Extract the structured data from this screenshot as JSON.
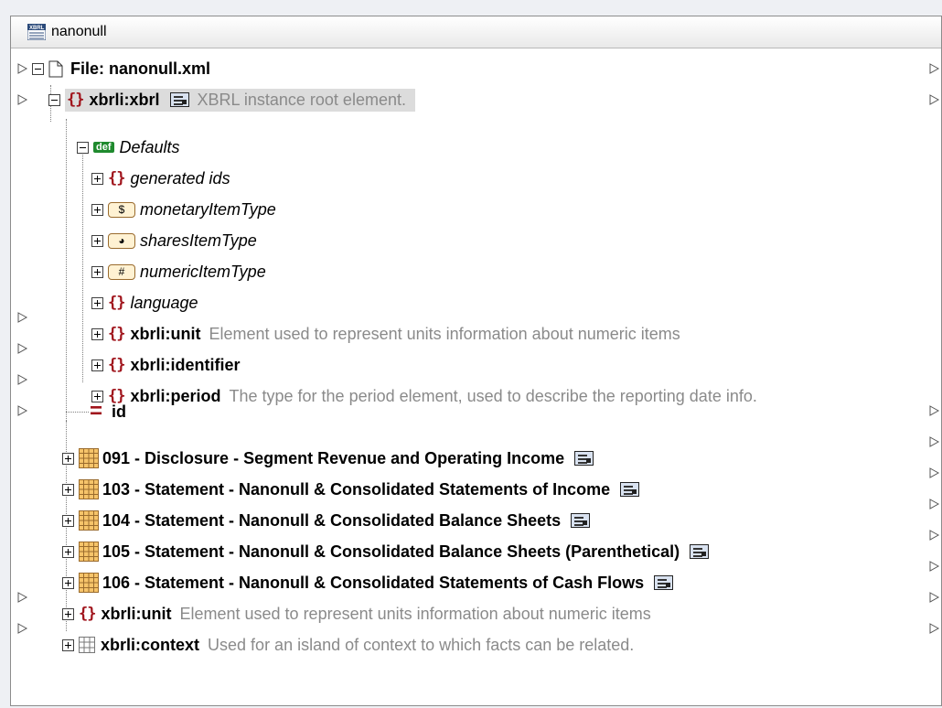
{
  "window": {
    "title": "nanonull",
    "title_icon": "xbrl-component-icon"
  },
  "tree": [
    {
      "label": "File: nanonull.xml",
      "icon": "file-icon",
      "toggle": "minus"
    },
    {
      "label": "xbrli:xbrl",
      "desc": "XBRL instance root element.",
      "icon": "element-icon",
      "toggle": "minus",
      "annotation": true
    },
    {
      "label": "Defaults",
      "icon": "def-icon",
      "icon_text": "def",
      "toggle": "minus"
    },
    {
      "label": "generated ids",
      "icon": "element-icon",
      "toggle": "plus"
    },
    {
      "label": "monetaryItemType",
      "icon": "monetary-type-icon",
      "icon_text": "$",
      "toggle": "plus"
    },
    {
      "label": "sharesItemType",
      "icon": "shares-type-icon",
      "icon_text": "◕",
      "toggle": "plus"
    },
    {
      "label": "numericItemType",
      "icon": "numeric-type-icon",
      "icon_text": "#",
      "toggle": "plus"
    },
    {
      "label": "language",
      "icon": "element-icon",
      "toggle": "plus"
    },
    {
      "label": "xbrli:unit",
      "desc": "Element used to represent units information about numeric items",
      "icon": "element-icon",
      "toggle": "plus"
    },
    {
      "label": "xbrli:identifier",
      "icon": "element-icon",
      "toggle": "plus"
    },
    {
      "label": "xbrli:period",
      "desc": "The type for the period element, used to describe the reporting date info.",
      "icon": "element-icon",
      "toggle": "plus"
    },
    {
      "label": "id",
      "icon": "attribute-icon"
    },
    {
      "label": "091 - Disclosure - Segment Revenue and Operating Income",
      "icon": "table-icon",
      "toggle": "plus",
      "annotation": true
    },
    {
      "label": "103 - Statement - Nanonull & Consolidated Statements of Income",
      "icon": "table-icon",
      "toggle": "plus",
      "annotation": true
    },
    {
      "label": "104 - Statement - Nanonull & Consolidated Balance Sheets",
      "icon": "table-icon",
      "toggle": "plus",
      "annotation": true
    },
    {
      "label": "105 - Statement - Nanonull & Consolidated Balance Sheets (Parenthetical)",
      "icon": "table-icon",
      "toggle": "plus",
      "annotation": true
    },
    {
      "label": "106 - Statement - Nanonull & Consolidated Statements of Cash Flows",
      "icon": "table-icon",
      "toggle": "plus",
      "annotation": true
    },
    {
      "label": "xbrli:unit",
      "desc": "Element used to represent units information about numeric items",
      "icon": "element-icon",
      "toggle": "plus"
    },
    {
      "label": "xbrli:context",
      "desc": "Used for an island of context to which facts can be related.",
      "icon": "context-icon",
      "toggle": "plus"
    }
  ],
  "colors": {
    "element_bracket": "#a0141c",
    "table_icon": "#e0a040",
    "desc_text": "#8a8a8a",
    "selection": "#dcdcdc",
    "def_badge": "#1f8a2e"
  }
}
